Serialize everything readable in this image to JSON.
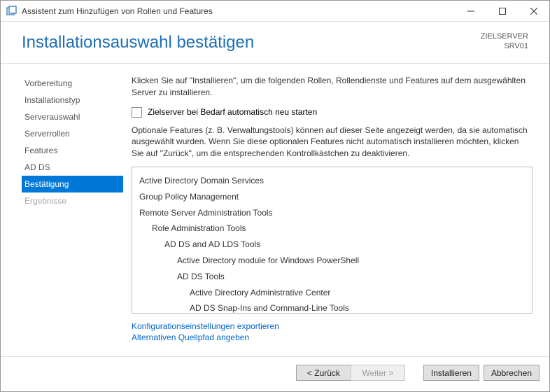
{
  "window": {
    "title": "Assistent zum Hinzufügen von Rollen und Features"
  },
  "header": {
    "page_title": "Installationsauswahl bestätigen",
    "target_label": "ZIELSERVER",
    "target_value": "SRV01"
  },
  "sidebar": {
    "items": [
      {
        "label": "Vorbereitung",
        "state": "normal"
      },
      {
        "label": "Installationstyp",
        "state": "normal"
      },
      {
        "label": "Serverauswahl",
        "state": "normal"
      },
      {
        "label": "Serverrollen",
        "state": "normal"
      },
      {
        "label": "Features",
        "state": "normal"
      },
      {
        "label": "AD DS",
        "state": "normal"
      },
      {
        "label": "Bestätigung",
        "state": "active"
      },
      {
        "label": "Ergebnisse",
        "state": "disabled"
      }
    ]
  },
  "main": {
    "intro": "Klicken Sie auf \"Installieren\", um die folgenden Rollen, Rollendienste und Features auf dem ausgewählten Server zu installieren.",
    "restart_checkbox_label": "Zielserver bei Bedarf automatisch neu starten",
    "restart_checked": false,
    "optional_note": "Optionale Features (z. B. Verwaltungstools) können auf dieser Seite angezeigt werden, da sie automatisch ausgewählt wurden. Wenn Sie diese optionalen Features nicht automatisch installieren möchten, klicken Sie auf \"Zurück\", um die entsprechenden Kontrollkästchen zu deaktivieren.",
    "selections": [
      {
        "label": "Active Directory Domain Services",
        "indent": 0
      },
      {
        "label": "Group Policy Management",
        "indent": 0
      },
      {
        "label": "Remote Server Administration Tools",
        "indent": 0
      },
      {
        "label": "Role Administration Tools",
        "indent": 1
      },
      {
        "label": "AD DS and AD LDS Tools",
        "indent": 2
      },
      {
        "label": "Active Directory module for Windows PowerShell",
        "indent": 3
      },
      {
        "label": "AD DS Tools",
        "indent": 3
      },
      {
        "label": "Active Directory Administrative Center",
        "indent": 4
      },
      {
        "label": "AD DS Snap-Ins and Command-Line Tools",
        "indent": 4
      }
    ],
    "links": {
      "export": "Konfigurationseinstellungen exportieren",
      "altpath": "Alternativen Quellpfad angeben"
    }
  },
  "footer": {
    "back": "< Zurück",
    "next": "Weiter >",
    "install": "Installieren",
    "cancel": "Abbrechen"
  }
}
